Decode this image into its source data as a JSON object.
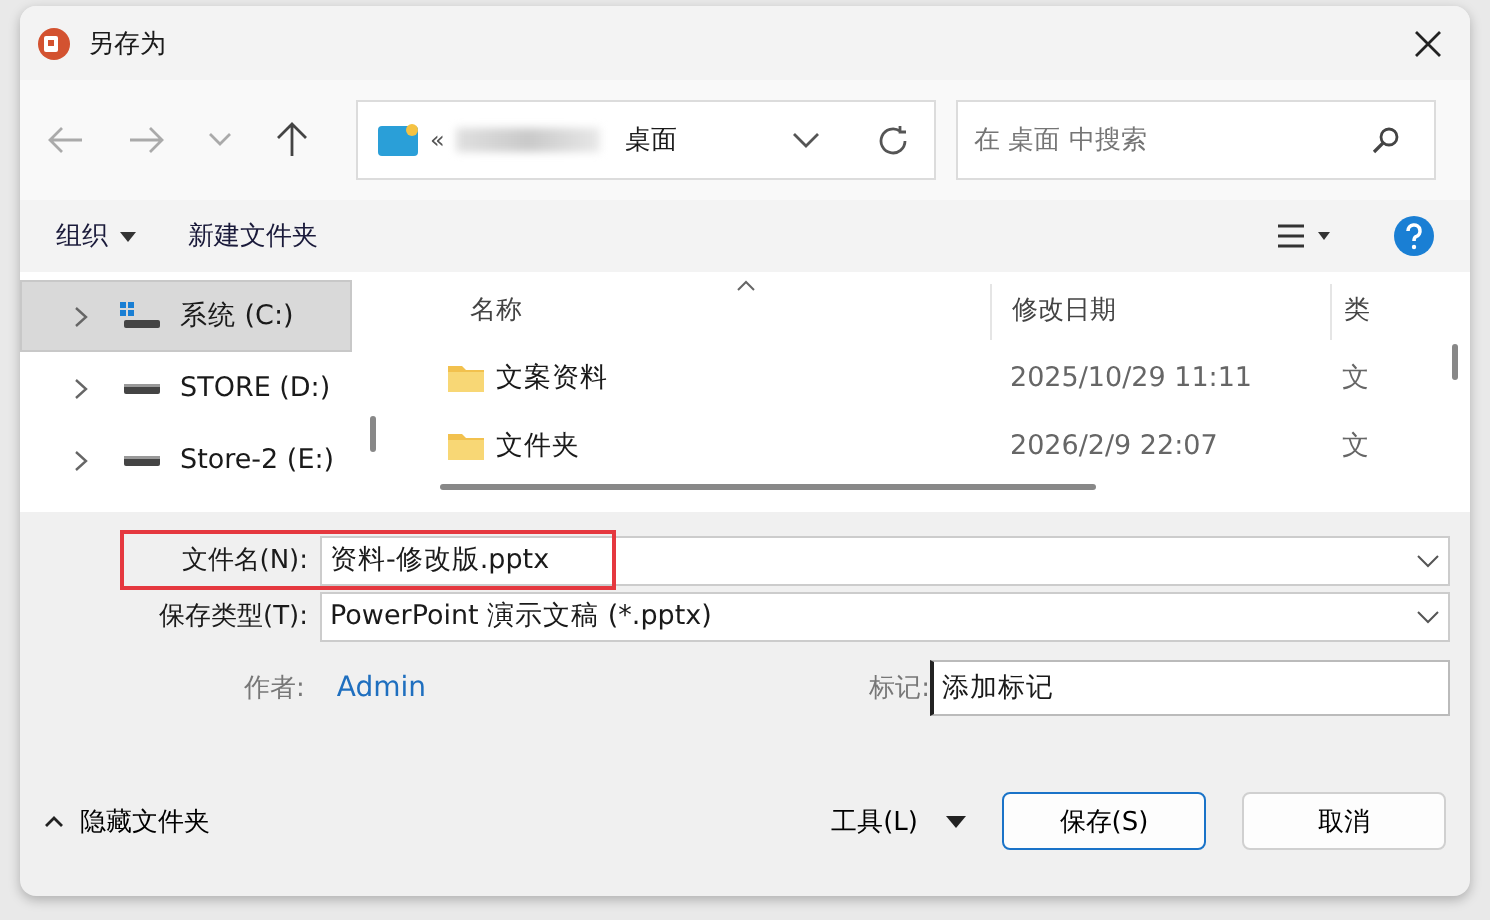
{
  "window": {
    "title": "另存为"
  },
  "nav": {
    "breadcrumb_separator": "«",
    "location": "桌面",
    "search": {
      "placeholder": "在 桌面 中搜索"
    }
  },
  "toolbar": {
    "organize": "组织",
    "new_folder": "新建文件夹"
  },
  "sidebar": {
    "items": [
      {
        "label": "系统 (C:)",
        "kind": "system",
        "selected": true
      },
      {
        "label": "STORE (D:)",
        "kind": "drive",
        "selected": false
      },
      {
        "label": "Store-2 (E:)",
        "kind": "drive",
        "selected": false
      }
    ]
  },
  "file_list": {
    "columns": [
      "名称",
      "修改日期",
      "类"
    ],
    "rows": [
      {
        "name": "文案资料",
        "modified": "2025/10/29 11:11",
        "column_3": "文"
      },
      {
        "name": "文件夹",
        "modified": "2026/2/9 22:07",
        "column_3": "文"
      }
    ]
  },
  "form": {
    "file_name": {
      "label": "文件名(N):",
      "value": "资料-修改版.pptx",
      "highlighted": true
    },
    "save_type": {
      "label": "保存类型(T):",
      "value": "PowerPoint 演示文稿 (*.pptx)"
    },
    "author": {
      "label": "作者:",
      "value": "Admin"
    },
    "tags": {
      "label": "标记:",
      "value": "添加标记"
    }
  },
  "footer": {
    "hide_folders": "隐藏文件夹",
    "tools": "工具(L)",
    "save": "保存(S)",
    "cancel": "取消"
  }
}
